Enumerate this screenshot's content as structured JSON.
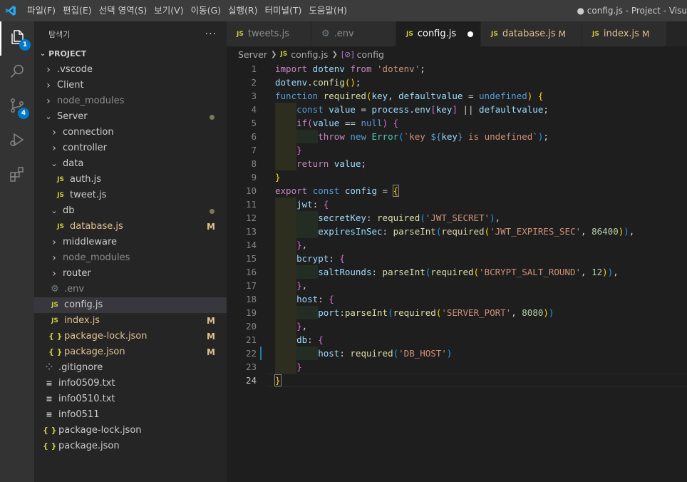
{
  "titlebar": {
    "menu": [
      "파일(F)",
      "편집(E)",
      "선택 영역(S)",
      "보기(V)",
      "이동(G)",
      "실행(R)",
      "터미널(T)",
      "도움말(H)"
    ],
    "title": "● config.js - Project - Visu"
  },
  "activity": {
    "explorer_badge": "1",
    "scm_badge": "4",
    "icons": [
      "files-icon",
      "search-icon",
      "source-control-icon",
      "run-debug-icon",
      "extensions-icon"
    ]
  },
  "sidebar": {
    "title": "탐색기",
    "more": "···",
    "project": "PROJECT",
    "tree": [
      {
        "label": ".vscode",
        "type": "folder",
        "open": false,
        "depth": 1
      },
      {
        "label": "Client",
        "type": "folder",
        "open": false,
        "depth": 1
      },
      {
        "label": "node_modules",
        "type": "folder",
        "open": false,
        "depth": 1,
        "dim": true
      },
      {
        "label": "Server",
        "type": "folder",
        "open": true,
        "depth": 1,
        "dot": true
      },
      {
        "label": "connection",
        "type": "folder",
        "open": false,
        "depth": 2
      },
      {
        "label": "controller",
        "type": "folder",
        "open": false,
        "depth": 2
      },
      {
        "label": "data",
        "type": "folder",
        "open": true,
        "depth": 2
      },
      {
        "label": "auth.js",
        "type": "js",
        "depth": 3
      },
      {
        "label": "tweet.js",
        "type": "js",
        "depth": 3
      },
      {
        "label": "db",
        "type": "folder",
        "open": true,
        "depth": 2,
        "dot": true
      },
      {
        "label": "database.js",
        "type": "js",
        "depth": 3,
        "modified": true,
        "mark": "M"
      },
      {
        "label": "middleware",
        "type": "folder",
        "open": false,
        "depth": 2
      },
      {
        "label": "node_modules",
        "type": "folder",
        "open": false,
        "depth": 2,
        "dim": true
      },
      {
        "label": "router",
        "type": "folder",
        "open": false,
        "depth": 2
      },
      {
        "label": ".env",
        "type": "gear",
        "depth": 2,
        "dim": true
      },
      {
        "label": "config.js",
        "type": "js",
        "depth": 2,
        "selected": true
      },
      {
        "label": "index.js",
        "type": "js",
        "depth": 2,
        "modified": true,
        "mark": "M"
      },
      {
        "label": "package-lock.json",
        "type": "json",
        "depth": 2,
        "modified": true,
        "mark": "M"
      },
      {
        "label": "package.json",
        "type": "json",
        "depth": 2,
        "modified": true,
        "mark": "M"
      },
      {
        "label": ".gitignore",
        "type": "dotfile",
        "depth": 1
      },
      {
        "label": "info0509.txt",
        "type": "txt",
        "depth": 1
      },
      {
        "label": "info0510.txt",
        "type": "txt",
        "depth": 1
      },
      {
        "label": "info0511",
        "type": "txt",
        "depth": 1
      },
      {
        "label": "package-lock.json",
        "type": "json",
        "depth": 1
      },
      {
        "label": "package.json",
        "type": "json",
        "depth": 1
      }
    ]
  },
  "tabs": [
    {
      "label": "tweets.js",
      "icon": "JS"
    },
    {
      "label": ".env",
      "icon": "gear"
    },
    {
      "label": "config.js",
      "icon": "JS",
      "active": true,
      "unsaved": true
    },
    {
      "label": "database.js",
      "icon": "JS",
      "modified": true,
      "mark": "M"
    },
    {
      "label": "index.js",
      "icon": "JS",
      "modified": true,
      "mark": "M"
    }
  ],
  "breadcrumb": {
    "folder": "Server",
    "file_icon": "JS",
    "file": "config.js",
    "symbol": "config"
  },
  "editor": {
    "current_line": 24,
    "modified_line": 22,
    "lines": [
      [
        [
          "import",
          "k"
        ],
        [
          " dotenv ",
          "v"
        ],
        [
          "from",
          "k"
        ],
        [
          " ",
          "p"
        ],
        [
          "'dotenv'",
          "str"
        ],
        [
          ";",
          "p"
        ]
      ],
      [
        [
          "dotenv",
          "v"
        ],
        [
          ".",
          "p"
        ],
        [
          "config",
          "f"
        ],
        [
          "()",
          "b1"
        ],
        [
          ";",
          "p"
        ]
      ],
      [
        [
          "function",
          "s"
        ],
        [
          " ",
          "p"
        ],
        [
          "required",
          "f"
        ],
        [
          "(",
          "b1"
        ],
        [
          "key",
          "v"
        ],
        [
          ", ",
          "p"
        ],
        [
          "defaultvalue",
          "v"
        ],
        [
          " = ",
          "p"
        ],
        [
          "undefined",
          "s"
        ],
        [
          ")",
          "b1"
        ],
        [
          " ",
          "p"
        ],
        [
          "{",
          "b1"
        ]
      ],
      [
        [
          "    ",
          "p"
        ],
        [
          "const",
          "s"
        ],
        [
          " ",
          "p"
        ],
        [
          "value",
          "v"
        ],
        [
          " = ",
          "p"
        ],
        [
          "process",
          "v"
        ],
        [
          ".",
          "p"
        ],
        [
          "env",
          "v"
        ],
        [
          "[",
          "b2"
        ],
        [
          "key",
          "v"
        ],
        [
          "]",
          "b2"
        ],
        [
          " || ",
          "p"
        ],
        [
          "defaultvalue",
          "v"
        ],
        [
          ";",
          "p"
        ]
      ],
      [
        [
          "    ",
          "p"
        ],
        [
          "if",
          "k"
        ],
        [
          "(",
          "b2"
        ],
        [
          "value",
          "v"
        ],
        [
          " == ",
          "p"
        ],
        [
          "null",
          "s"
        ],
        [
          ")",
          "b2"
        ],
        [
          " ",
          "p"
        ],
        [
          "{",
          "b2"
        ]
      ],
      [
        [
          "        ",
          "p"
        ],
        [
          "throw",
          "k"
        ],
        [
          " ",
          "p"
        ],
        [
          "new",
          "s"
        ],
        [
          " ",
          "p"
        ],
        [
          "Error",
          "t"
        ],
        [
          "(",
          "b3"
        ],
        [
          "`key ",
          "str"
        ],
        [
          "${",
          "s"
        ],
        [
          "key",
          "v"
        ],
        [
          "}",
          "s"
        ],
        [
          " is undefined`",
          "str"
        ],
        [
          ")",
          "b3"
        ],
        [
          ";",
          "p"
        ]
      ],
      [
        [
          "    ",
          "p"
        ],
        [
          "}",
          "b2"
        ]
      ],
      [
        [
          "    ",
          "p"
        ],
        [
          "return",
          "k"
        ],
        [
          " ",
          "p"
        ],
        [
          "value",
          "v"
        ],
        [
          ";",
          "p"
        ]
      ],
      [
        [
          "}",
          "b1"
        ]
      ],
      [
        [
          "export",
          "k"
        ],
        [
          " ",
          "p"
        ],
        [
          "const",
          "s"
        ],
        [
          " ",
          "p"
        ],
        [
          "config",
          "v"
        ],
        [
          " = ",
          "p"
        ],
        [
          "{",
          "b1 matchbr"
        ]
      ],
      [
        [
          "    ",
          "p"
        ],
        [
          "jwt",
          "v"
        ],
        [
          ": ",
          "p"
        ],
        [
          "{",
          "b2"
        ]
      ],
      [
        [
          "        ",
          "p"
        ],
        [
          "secretKey",
          "v"
        ],
        [
          ": ",
          "p"
        ],
        [
          "required",
          "f"
        ],
        [
          "(",
          "b3"
        ],
        [
          "'JWT_SECRET'",
          "str"
        ],
        [
          ")",
          "b3"
        ],
        [
          ",",
          "p"
        ]
      ],
      [
        [
          "        ",
          "p"
        ],
        [
          "expiresInSec",
          "v"
        ],
        [
          ": ",
          "p"
        ],
        [
          "parseInt",
          "f"
        ],
        [
          "(",
          "b3"
        ],
        [
          "required",
          "f"
        ],
        [
          "(",
          "b1"
        ],
        [
          "'JWT_EXPIRES_SEC'",
          "str"
        ],
        [
          ", ",
          "p"
        ],
        [
          "86400",
          "n"
        ],
        [
          ")",
          "b1"
        ],
        [
          ")",
          "b3"
        ],
        [
          ",",
          "p"
        ]
      ],
      [
        [
          "    ",
          "p"
        ],
        [
          "}",
          "b2"
        ],
        [
          ",",
          "p"
        ]
      ],
      [
        [
          "    ",
          "p"
        ],
        [
          "bcrypt",
          "v"
        ],
        [
          ": ",
          "p"
        ],
        [
          "{",
          "b2"
        ]
      ],
      [
        [
          "        ",
          "p"
        ],
        [
          "saltRounds",
          "v"
        ],
        [
          ": ",
          "p"
        ],
        [
          "parseInt",
          "f"
        ],
        [
          "(",
          "b3"
        ],
        [
          "required",
          "f"
        ],
        [
          "(",
          "b1"
        ],
        [
          "'BCRYPT_SALT_ROUND'",
          "str"
        ],
        [
          ", ",
          "p"
        ],
        [
          "12",
          "n"
        ],
        [
          ")",
          "b1"
        ],
        [
          ")",
          "b3"
        ],
        [
          ",",
          "p"
        ]
      ],
      [
        [
          "    ",
          "p"
        ],
        [
          "}",
          "b2"
        ],
        [
          ",",
          "p"
        ]
      ],
      [
        [
          "    ",
          "p"
        ],
        [
          "host",
          "v"
        ],
        [
          ": ",
          "p"
        ],
        [
          "{",
          "b2"
        ]
      ],
      [
        [
          "        ",
          "p"
        ],
        [
          "port",
          "v"
        ],
        [
          ":",
          "p"
        ],
        [
          "parseInt",
          "f"
        ],
        [
          "(",
          "b3"
        ],
        [
          "required",
          "f"
        ],
        [
          "(",
          "b1"
        ],
        [
          "'SERVER_PORT'",
          "str"
        ],
        [
          ", ",
          "p"
        ],
        [
          "8080",
          "n"
        ],
        [
          ")",
          "b1"
        ],
        [
          ")",
          "b3"
        ]
      ],
      [
        [
          "    ",
          "p"
        ],
        [
          "}",
          "b2"
        ],
        [
          ",",
          "p"
        ]
      ],
      [
        [
          "    ",
          "p"
        ],
        [
          "db",
          "v"
        ],
        [
          ": ",
          "p"
        ],
        [
          "{",
          "b2"
        ]
      ],
      [
        [
          "        ",
          "p"
        ],
        [
          "host",
          "v"
        ],
        [
          ": ",
          "p"
        ],
        [
          "required",
          "f"
        ],
        [
          "(",
          "b3"
        ],
        [
          "'DB_HOST'",
          "str"
        ],
        [
          ")",
          "b3"
        ]
      ],
      [
        [
          "    ",
          "p"
        ],
        [
          "}",
          "b2"
        ]
      ],
      [
        [
          "}",
          "b1 matchbr"
        ]
      ]
    ]
  },
  "colors": {
    "accent": "#007acc",
    "modified": "#e2c08d"
  }
}
